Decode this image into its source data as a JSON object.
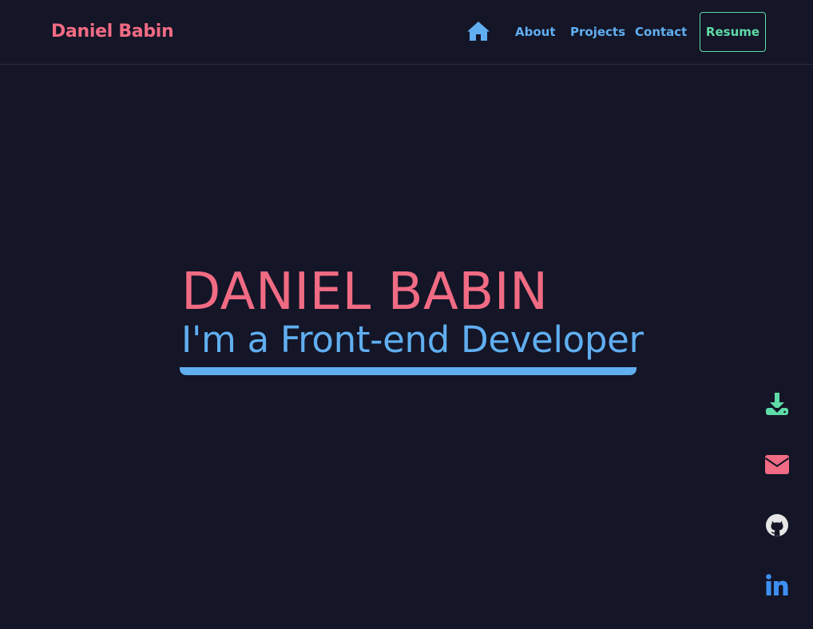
{
  "navbar": {
    "brand": "Daniel Babin",
    "home_icon": "home-icon",
    "links": [
      {
        "label": "About"
      },
      {
        "label": "Projects"
      },
      {
        "label": "Contact"
      }
    ],
    "resume_label": "Resume"
  },
  "hero": {
    "name": "DANIEL BABIN",
    "role": "I'm a Front-end Developer"
  },
  "social": [
    {
      "icon": "download-icon",
      "color": "#5fdba7"
    },
    {
      "icon": "mail-icon",
      "color": "#f06b83"
    },
    {
      "icon": "github-icon",
      "color": "#e6e6e6"
    },
    {
      "icon": "linkedin-icon",
      "color": "#3d8ff2"
    }
  ],
  "colors": {
    "background": "#141527",
    "accent_pink": "#f06b83",
    "accent_blue": "#60aef0",
    "accent_green": "#5fdba7"
  }
}
